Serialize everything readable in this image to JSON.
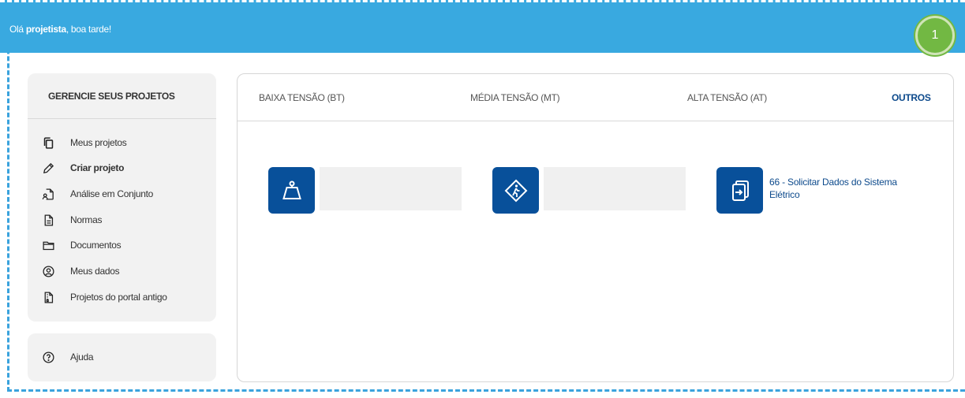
{
  "header": {
    "greeting_prefix": "Olá ",
    "user_name": "projetista",
    "greeting_suffix": ", boa tarde!",
    "marker_number": "1"
  },
  "sidebar": {
    "title": "GERENCIE SEUS PROJETOS",
    "items": [
      {
        "label": "Meus projetos",
        "icon": "copy-icon"
      },
      {
        "label": "Criar projeto",
        "icon": "pencil-icon"
      },
      {
        "label": "Análise em Conjunto",
        "icon": "shared-document-icon"
      },
      {
        "label": "Normas",
        "icon": "document-icon"
      },
      {
        "label": "Documentos",
        "icon": "folder-icon"
      },
      {
        "label": "Meus dados",
        "icon": "user-circle-icon"
      },
      {
        "label": "Projetos do portal antigo",
        "icon": "archive-file-icon"
      }
    ],
    "help_label": "Ajuda"
  },
  "tabs": [
    {
      "label": "BAIXA TENSÃO (BT)",
      "active": false
    },
    {
      "label": "MÉDIA TENSÃO (MT)",
      "active": false
    },
    {
      "label": "ALTA TENSÃO (AT)",
      "active": false
    },
    {
      "label": "OUTROS",
      "active": true
    }
  ],
  "cards": [
    {
      "icon": "weight-icon",
      "title": ""
    },
    {
      "icon": "pedestrian-sign-icon",
      "title": ""
    },
    {
      "icon": "login-document-icon",
      "title": "66 - Solicitar Dados do Sistema Elétrico"
    }
  ],
  "colors": {
    "header_bg": "#39a9e0",
    "accent_blue": "#08509a",
    "link_blue": "#0d4a8c",
    "marker_green": "#72b843"
  }
}
